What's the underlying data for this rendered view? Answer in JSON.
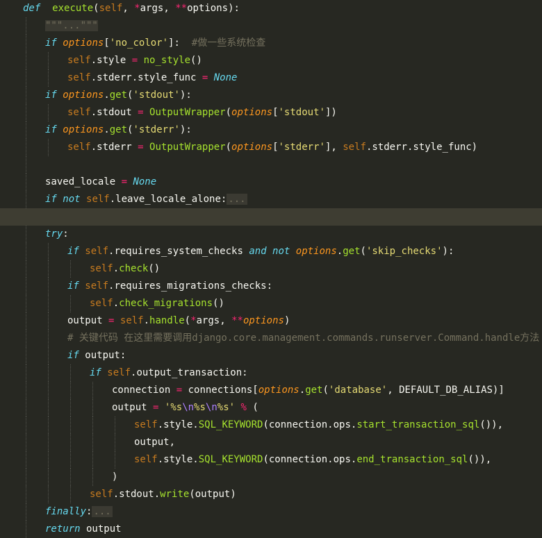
{
  "editor": {
    "theme": "monokai",
    "colors": {
      "background": "#272822",
      "current_line": "#3e3d32",
      "keyword": "#66d9ef",
      "function": "#a6e22e",
      "self": "#fd971f",
      "string": "#e6db74",
      "operator": "#f92672",
      "comment": "#75715e"
    },
    "lines": [
      {
        "indent": 1,
        "guides": 0,
        "tokens": [
          [
            "kw",
            "def"
          ],
          [
            "",
            "  "
          ],
          [
            "fn",
            "execute"
          ],
          [
            "",
            "("
          ],
          [
            "self",
            "self"
          ],
          [
            "",
            ", "
          ],
          [
            "op",
            "*"
          ],
          [
            "",
            "args, "
          ],
          [
            "op",
            "**"
          ],
          [
            "",
            "options):"
          ]
        ]
      },
      {
        "indent": 2,
        "guides": 1,
        "tokens": [
          [
            "docfold",
            "\"\"\"...\"\"\""
          ]
        ]
      },
      {
        "indent": 2,
        "guides": 1,
        "tokens": [
          [
            "kw",
            "if"
          ],
          [
            "",
            " "
          ],
          [
            "param",
            "options"
          ],
          [
            "",
            "["
          ],
          [
            "str",
            "'no_color'"
          ],
          [
            "",
            "]:  "
          ],
          [
            "cm",
            "#做一些系统检查"
          ]
        ]
      },
      {
        "indent": 3,
        "guides": 2,
        "tokens": [
          [
            "self",
            "self"
          ],
          [
            "",
            ".style "
          ],
          [
            "op",
            "="
          ],
          [
            "",
            " "
          ],
          [
            "fn",
            "no_style"
          ],
          [
            "",
            "()"
          ]
        ]
      },
      {
        "indent": 3,
        "guides": 2,
        "tokens": [
          [
            "self",
            "self"
          ],
          [
            "",
            ".stderr.style_func "
          ],
          [
            "op",
            "="
          ],
          [
            "",
            " "
          ],
          [
            "const",
            "None"
          ]
        ]
      },
      {
        "indent": 2,
        "guides": 1,
        "tokens": [
          [
            "kw",
            "if"
          ],
          [
            "",
            " "
          ],
          [
            "param",
            "options"
          ],
          [
            "",
            "."
          ],
          [
            "fn",
            "get"
          ],
          [
            "",
            "("
          ],
          [
            "str",
            "'stdout'"
          ],
          [
            "",
            "):"
          ]
        ]
      },
      {
        "indent": 3,
        "guides": 2,
        "tokens": [
          [
            "self",
            "self"
          ],
          [
            "",
            ".stdout "
          ],
          [
            "op",
            "="
          ],
          [
            "",
            " "
          ],
          [
            "fn",
            "OutputWrapper"
          ],
          [
            "",
            "("
          ],
          [
            "param",
            "options"
          ],
          [
            "",
            "["
          ],
          [
            "str",
            "'stdout'"
          ],
          [
            "",
            "])"
          ]
        ]
      },
      {
        "indent": 2,
        "guides": 1,
        "tokens": [
          [
            "kw",
            "if"
          ],
          [
            "",
            " "
          ],
          [
            "param",
            "options"
          ],
          [
            "",
            "."
          ],
          [
            "fn",
            "get"
          ],
          [
            "",
            "("
          ],
          [
            "str",
            "'stderr'"
          ],
          [
            "",
            "):"
          ]
        ]
      },
      {
        "indent": 3,
        "guides": 2,
        "tokens": [
          [
            "self",
            "self"
          ],
          [
            "",
            ".stderr "
          ],
          [
            "op",
            "="
          ],
          [
            "",
            " "
          ],
          [
            "fn",
            "OutputWrapper"
          ],
          [
            "",
            "("
          ],
          [
            "param",
            "options"
          ],
          [
            "",
            "["
          ],
          [
            "str",
            "'stderr'"
          ],
          [
            "",
            "], "
          ],
          [
            "self",
            "self"
          ],
          [
            "",
            ".stderr.style_func)"
          ]
        ]
      },
      {
        "indent": 0,
        "guides": 1,
        "tokens": []
      },
      {
        "indent": 2,
        "guides": 1,
        "tokens": [
          [
            "",
            "saved_locale "
          ],
          [
            "op",
            "="
          ],
          [
            "",
            " "
          ],
          [
            "const",
            "None"
          ]
        ]
      },
      {
        "indent": 2,
        "guides": 1,
        "tokens": [
          [
            "kw",
            "if not"
          ],
          [
            "",
            " "
          ],
          [
            "self",
            "self"
          ],
          [
            "",
            ".leave_locale_alone:"
          ],
          [
            "fold",
            "..."
          ]
        ]
      },
      {
        "indent": 0,
        "guides": 0,
        "tokens": [],
        "current": true
      },
      {
        "indent": 2,
        "guides": 1,
        "tokens": [
          [
            "kw",
            "try"
          ],
          [
            "",
            ":"
          ]
        ]
      },
      {
        "indent": 3,
        "guides": 2,
        "tokens": [
          [
            "kw",
            "if"
          ],
          [
            "",
            " "
          ],
          [
            "self",
            "self"
          ],
          [
            "",
            ".requires_system_checks "
          ],
          [
            "kw",
            "and not"
          ],
          [
            "",
            " "
          ],
          [
            "param",
            "options"
          ],
          [
            "",
            "."
          ],
          [
            "fn",
            "get"
          ],
          [
            "",
            "("
          ],
          [
            "str",
            "'skip_checks'"
          ],
          [
            "",
            "):"
          ]
        ]
      },
      {
        "indent": 4,
        "guides": 3,
        "tokens": [
          [
            "self",
            "self"
          ],
          [
            "",
            "."
          ],
          [
            "fn",
            "check"
          ],
          [
            "",
            "()"
          ]
        ]
      },
      {
        "indent": 3,
        "guides": 2,
        "tokens": [
          [
            "kw",
            "if"
          ],
          [
            "",
            " "
          ],
          [
            "self",
            "self"
          ],
          [
            "",
            ".requires_migrations_checks:"
          ]
        ]
      },
      {
        "indent": 4,
        "guides": 3,
        "tokens": [
          [
            "self",
            "self"
          ],
          [
            "",
            "."
          ],
          [
            "fn",
            "check_migrations"
          ],
          [
            "",
            "()"
          ]
        ]
      },
      {
        "indent": 3,
        "guides": 2,
        "tokens": [
          [
            "",
            "output "
          ],
          [
            "op",
            "="
          ],
          [
            "",
            " "
          ],
          [
            "self",
            "self"
          ],
          [
            "",
            "."
          ],
          [
            "fn",
            "handle"
          ],
          [
            "",
            "("
          ],
          [
            "op",
            "*"
          ],
          [
            "",
            "args, "
          ],
          [
            "op",
            "**"
          ],
          [
            "param",
            "options"
          ],
          [
            "",
            ")"
          ]
        ]
      },
      {
        "indent": 3,
        "guides": 2,
        "tokens": [
          [
            "cm",
            "# 关键代码 在这里需要调用django.core.management.commands.runserver.Command.handle方法"
          ]
        ]
      },
      {
        "indent": 3,
        "guides": 2,
        "tokens": [
          [
            "kw",
            "if"
          ],
          [
            "",
            " output:"
          ]
        ]
      },
      {
        "indent": 4,
        "guides": 3,
        "tokens": [
          [
            "kw",
            "if"
          ],
          [
            "",
            " "
          ],
          [
            "self",
            "self"
          ],
          [
            "",
            ".output_transaction:"
          ]
        ]
      },
      {
        "indent": 5,
        "guides": 4,
        "tokens": [
          [
            "",
            "connection "
          ],
          [
            "op",
            "="
          ],
          [
            "",
            " connections["
          ],
          [
            "param",
            "options"
          ],
          [
            "",
            "."
          ],
          [
            "fn",
            "get"
          ],
          [
            "",
            "("
          ],
          [
            "str",
            "'database'"
          ],
          [
            "",
            ", DEFAULT_DB_ALIAS)]"
          ]
        ]
      },
      {
        "indent": 5,
        "guides": 4,
        "tokens": [
          [
            "",
            "output "
          ],
          [
            "op",
            "="
          ],
          [
            "",
            " "
          ],
          [
            "str",
            "'%s"
          ],
          [
            "esc",
            "\\n"
          ],
          [
            "str",
            "%s"
          ],
          [
            "esc",
            "\\n"
          ],
          [
            "str",
            "%s'"
          ],
          [
            "",
            " "
          ],
          [
            "op",
            "%"
          ],
          [
            "",
            " ("
          ]
        ]
      },
      {
        "indent": 6,
        "guides": 5,
        "tokens": [
          [
            "self",
            "self"
          ],
          [
            "",
            ".style."
          ],
          [
            "fn",
            "SQL_KEYWORD"
          ],
          [
            "",
            "(connection.ops."
          ],
          [
            "fn",
            "start_transaction_sql"
          ],
          [
            "",
            "()),"
          ]
        ]
      },
      {
        "indent": 6,
        "guides": 5,
        "tokens": [
          [
            "",
            "output,"
          ]
        ]
      },
      {
        "indent": 6,
        "guides": 5,
        "tokens": [
          [
            "self",
            "self"
          ],
          [
            "",
            ".style."
          ],
          [
            "fn",
            "SQL_KEYWORD"
          ],
          [
            "",
            "(connection.ops."
          ],
          [
            "fn",
            "end_transaction_sql"
          ],
          [
            "",
            "()),"
          ]
        ]
      },
      {
        "indent": 5,
        "guides": 4,
        "tokens": [
          [
            "",
            ")"
          ]
        ]
      },
      {
        "indent": 4,
        "guides": 3,
        "tokens": [
          [
            "self",
            "self"
          ],
          [
            "",
            ".stdout."
          ],
          [
            "fn",
            "write"
          ],
          [
            "",
            "(output)"
          ]
        ]
      },
      {
        "indent": 2,
        "guides": 1,
        "tokens": [
          [
            "kw",
            "finally"
          ],
          [
            "",
            ":"
          ],
          [
            "fold",
            "..."
          ]
        ]
      },
      {
        "indent": 2,
        "guides": 1,
        "tokens": [
          [
            "kw",
            "return"
          ],
          [
            "",
            " output"
          ]
        ]
      }
    ]
  }
}
